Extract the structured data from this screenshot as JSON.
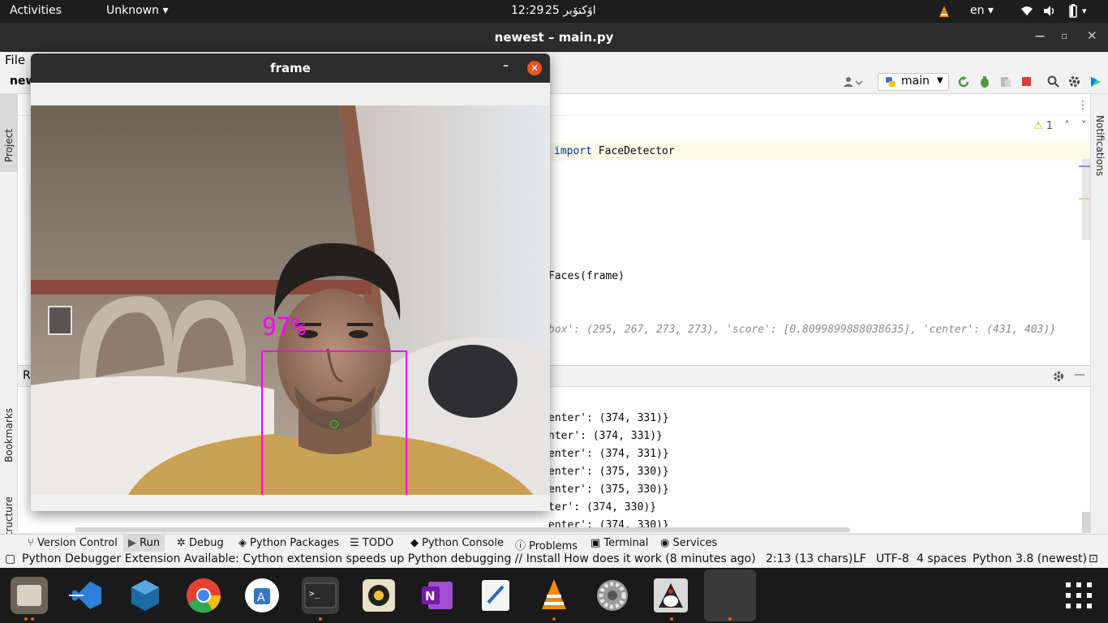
{
  "topbar": {
    "activities": "Activities",
    "app_menu": "Unknown ▾",
    "clock_time": "12:29",
    "clock_date": "25 اۆكتۆبر",
    "language": "en ▾"
  },
  "ide": {
    "title": "newest – main.py",
    "menu_file": "File",
    "project_name": "new",
    "run_config": "main",
    "problems_count": "1",
    "code_line1_kw": "import",
    "code_line1_rest": " FaceDetector",
    "code_line2": "Faces(frame)",
    "code_line3": "box': (295, 267, 273, 273), 'score': [0.8099899888038635], 'center': (431, 403)}",
    "left_tabs": [
      "Project",
      "Bookmarks",
      "Structure"
    ],
    "right_tabs": [
      "Notifications"
    ],
    "run_label": "R"
  },
  "run_output": [
    "enter': (374, 331)}",
    "nter': (374, 331)}",
    "enter': (374, 331)}",
    "enter': (375, 330)}",
    "enter': (375, 330)}",
    "ter': (374, 330)}",
    "enter': (374, 330)}"
  ],
  "tooltabs": {
    "version_control": "Version Control",
    "run": "Run",
    "debug": "Debug",
    "python_packages": "Python Packages",
    "todo": "TODO",
    "python_console": "Python Console",
    "problems": "Problems",
    "terminal": "Terminal",
    "services": "Services"
  },
  "statusbar": {
    "message": "Python Debugger Extension Available: Cython extension speeds up Python debugging // Install   How does it work (8 minutes ago)",
    "position": "2:13 (13 chars)",
    "line_sep": "LF",
    "encoding": "UTF-8",
    "indent": "4 spaces",
    "interpreter": "Python 3.8 (newest)"
  },
  "frame_window": {
    "title": "frame",
    "score_label": "97%"
  },
  "colors": {
    "detection_box": "#ff00ff",
    "center_dot": "#00ff00",
    "ubuntu_orange": "#e95420"
  },
  "dock_icons": [
    "files-icon",
    "vscode-icon",
    "virtualbox-icon",
    "chrome-icon",
    "app-store-icon",
    "terminal-icon",
    "rhythmbox-icon",
    "onenote-icon",
    "text-editor-icon",
    "vlc-icon",
    "settings-icon",
    "java-icon",
    "blank-app-icon",
    "show-apps-icon"
  ]
}
